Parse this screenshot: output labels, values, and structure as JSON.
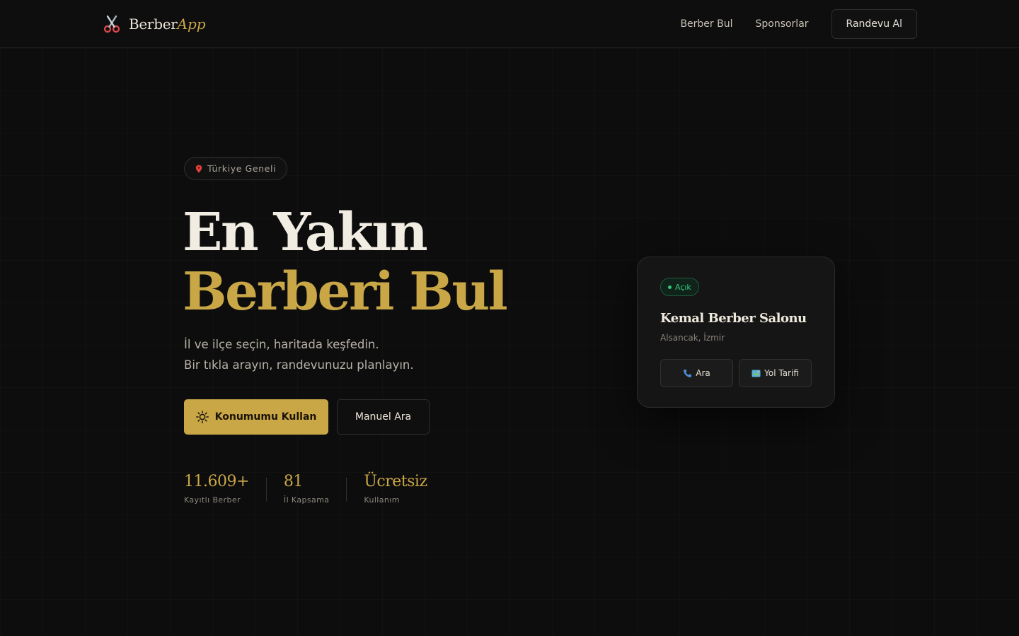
{
  "header": {
    "logo_text": "Berber",
    "logo_accent": "App",
    "logo_icon": "scissors-icon",
    "nav": [
      {
        "label": "Berber Bul"
      },
      {
        "label": "Sponsorlar"
      }
    ],
    "cta_label": "Randevu Al"
  },
  "hero": {
    "badge_icon": "map-pin-icon",
    "badge_text": "Türkiye Geneli",
    "title_line1": "En Yakın",
    "title_line2": "Berberi Bul",
    "subtitle_line1": "İl ve ilçe seçin, haritada keşfedin.",
    "subtitle_line2": "Bir tıkla arayın, randevunuzu planlayın.",
    "primary_button": "Konumumu Kullan",
    "primary_icon": "locate-icon",
    "secondary_button": "Manuel Ara"
  },
  "stats": [
    {
      "value": "11.609+",
      "label": "Kayıtlı Berber"
    },
    {
      "value": "81",
      "label": "İl Kapsama"
    },
    {
      "value": "Ücretsiz",
      "label": "Kullanım"
    }
  ],
  "card": {
    "status": "Açık",
    "name": "Kemal Berber Salonu",
    "location": "Alsancak, İzmir",
    "call_label": "Ara",
    "call_icon": "phone-icon",
    "route_label": "Yol Tarifi",
    "route_icon": "map-icon"
  },
  "colors": {
    "background": "#0d0d0d",
    "accent": "#c9a646",
    "status_green": "#37c77a",
    "text_primary": "#f2ede3"
  }
}
